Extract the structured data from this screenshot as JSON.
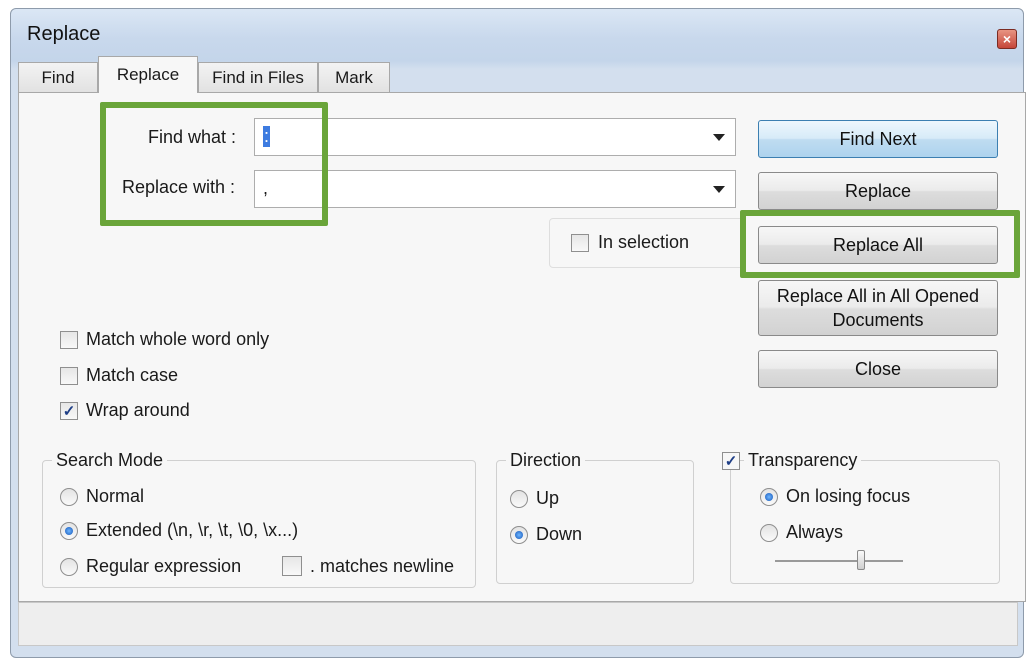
{
  "window": {
    "title": "Replace",
    "close_glyph": "×"
  },
  "tabs": [
    {
      "label": "Find"
    },
    {
      "label": "Replace"
    },
    {
      "label": "Find in Files"
    },
    {
      "label": "Mark"
    }
  ],
  "fields": {
    "find_label": "Find what :",
    "find_value": ":",
    "replace_label": "Replace with :",
    "replace_value": ","
  },
  "buttons": {
    "find_next": "Find Next",
    "replace": "Replace",
    "replace_all": "Replace All",
    "replace_all_opened_line1": "Replace All in All Opened",
    "replace_all_opened_line2": "Documents",
    "close": "Close"
  },
  "options": {
    "in_selection": {
      "label": "In selection",
      "checked": false
    },
    "match_whole_word": {
      "label": "Match whole word only",
      "checked": false
    },
    "match_case": {
      "label": "Match case",
      "checked": false
    },
    "wrap_around": {
      "label": "Wrap around",
      "checked": true
    }
  },
  "search_mode": {
    "title": "Search Mode",
    "normal": "Normal",
    "extended": "Extended (\\n, \\r, \\t, \\0, \\x...)",
    "regex": "Regular expression",
    "matches_newline": ". matches newline",
    "selected": "extended"
  },
  "direction": {
    "title": "Direction",
    "up": "Up",
    "down": "Down",
    "selected": "down"
  },
  "transparency": {
    "label": "Transparency",
    "checked": true,
    "on_losing_focus": "On losing focus",
    "always": "Always",
    "selected": "on_losing_focus",
    "level": 0.65
  },
  "check_glyph": "✓",
  "colors": {
    "highlight": "#6aa53a",
    "default_button": "#aed3ee"
  }
}
